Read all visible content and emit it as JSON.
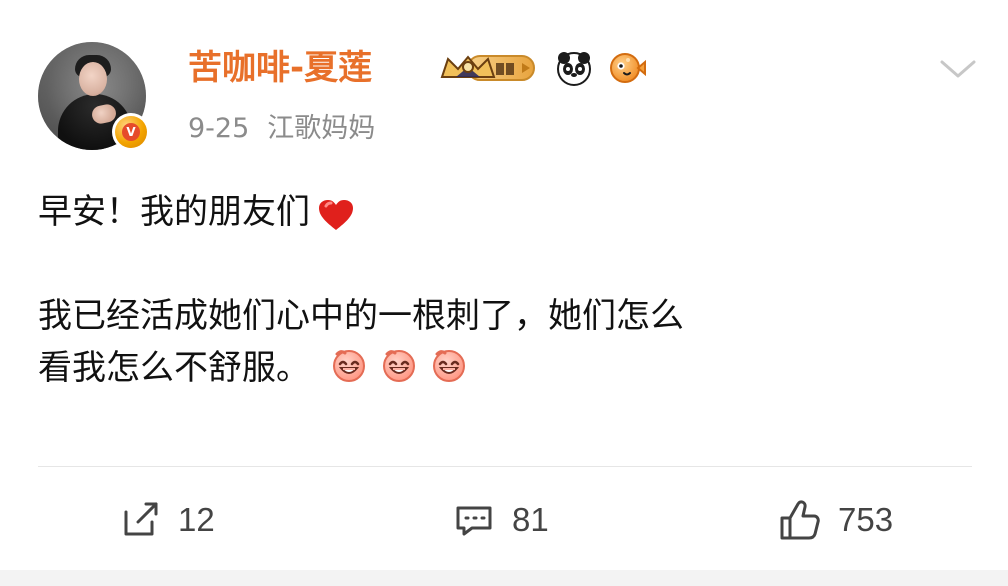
{
  "post": {
    "username": "苦咖啡-夏莲",
    "date": "9-25",
    "location": "江歌妈妈",
    "content": {
      "line1": "早安！我的朋友们",
      "line2": "我已经活成她们心中的一根刺了，她们怎么",
      "line3": "看我怎么不舒服。"
    },
    "icons": {
      "verified": "verified-v-badge",
      "crown": "crown-level-badge",
      "panda": "panda-emoji",
      "puffer": "pufferfish-emoji",
      "more": "chevron-down-icon",
      "heart": "red-heart-emoji",
      "laugh": "laughing-emoji"
    },
    "actions": {
      "share_count": "12",
      "comment_count": "81",
      "like_count": "753"
    },
    "colors": {
      "username": "#e8702a",
      "meta": "#8b8b8b",
      "text": "#111111",
      "divider": "#e6e6e6",
      "icon": "#444444"
    }
  }
}
